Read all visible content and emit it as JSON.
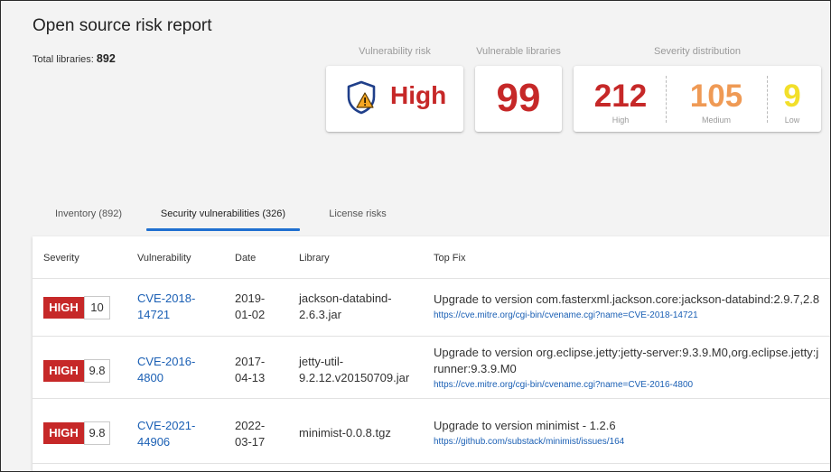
{
  "header": {
    "title": "Open source risk report",
    "total_label": "Total libraries:",
    "total_value": "892"
  },
  "summary": {
    "vulnerability_risk": {
      "caption": "Vulnerability risk",
      "value": "High",
      "icon": "shield-warning-icon"
    },
    "vulnerable_libraries": {
      "caption": "Vulnerable libraries",
      "value": "99"
    },
    "severity_distribution": {
      "caption": "Severity distribution",
      "items": [
        {
          "count": "212",
          "label": "High",
          "color": "#c62828"
        },
        {
          "count": "105",
          "label": "Medium",
          "color": "#ef9a55"
        },
        {
          "count": "9",
          "label": "Low",
          "color": "#f2df2a"
        }
      ]
    }
  },
  "tabs": [
    {
      "label": "Inventory (892)",
      "active": false
    },
    {
      "label": "Security vulnerabilities (326)",
      "active": true
    },
    {
      "label": "License risks",
      "active": false
    }
  ],
  "table": {
    "columns": [
      "Severity",
      "Vulnerability",
      "Date",
      "Library",
      "Top Fix"
    ],
    "rows": [
      {
        "severity": "HIGH",
        "score": "10",
        "cve_line1": "CVE-2018-",
        "cve_line2": "14721",
        "date_line1": "2019-",
        "date_line2": "01-02",
        "lib_line1": "jackson-databind-",
        "lib_line2": "2.6.3.jar",
        "fix_line1": "Upgrade to version com.fasterxml.jackson.core:jackson-databind:2.9.7,2.8",
        "fix_line2": "",
        "fix_url": "https://cve.mitre.org/cgi-bin/cvename.cgi?name=CVE-2018-14721"
      },
      {
        "severity": "HIGH",
        "score": "9.8",
        "cve_line1": "CVE-2016-",
        "cve_line2": "4800",
        "date_line1": "2017-",
        "date_line2": "04-13",
        "lib_line1": "jetty-util-",
        "lib_line2": "9.2.12.v20150709.jar",
        "fix_line1": "Upgrade to version org.eclipse.jetty:jetty-server:9.3.9.M0,org.eclipse.jetty:j",
        "fix_line2": "runner:9.3.9.M0",
        "fix_url": "https://cve.mitre.org/cgi-bin/cvename.cgi?name=CVE-2016-4800"
      },
      {
        "severity": "HIGH",
        "score": "9.8",
        "cve_line1": "CVE-2021-",
        "cve_line2": "44906",
        "date_line1": "2022-",
        "date_line2": "03-17",
        "lib_line1": "minimist-0.0.8.tgz",
        "lib_line2": "",
        "fix_line1": "Upgrade to version minimist - 1.2.6",
        "fix_line2": "",
        "fix_url": "https://github.com/substack/minimist/issues/164"
      }
    ]
  }
}
